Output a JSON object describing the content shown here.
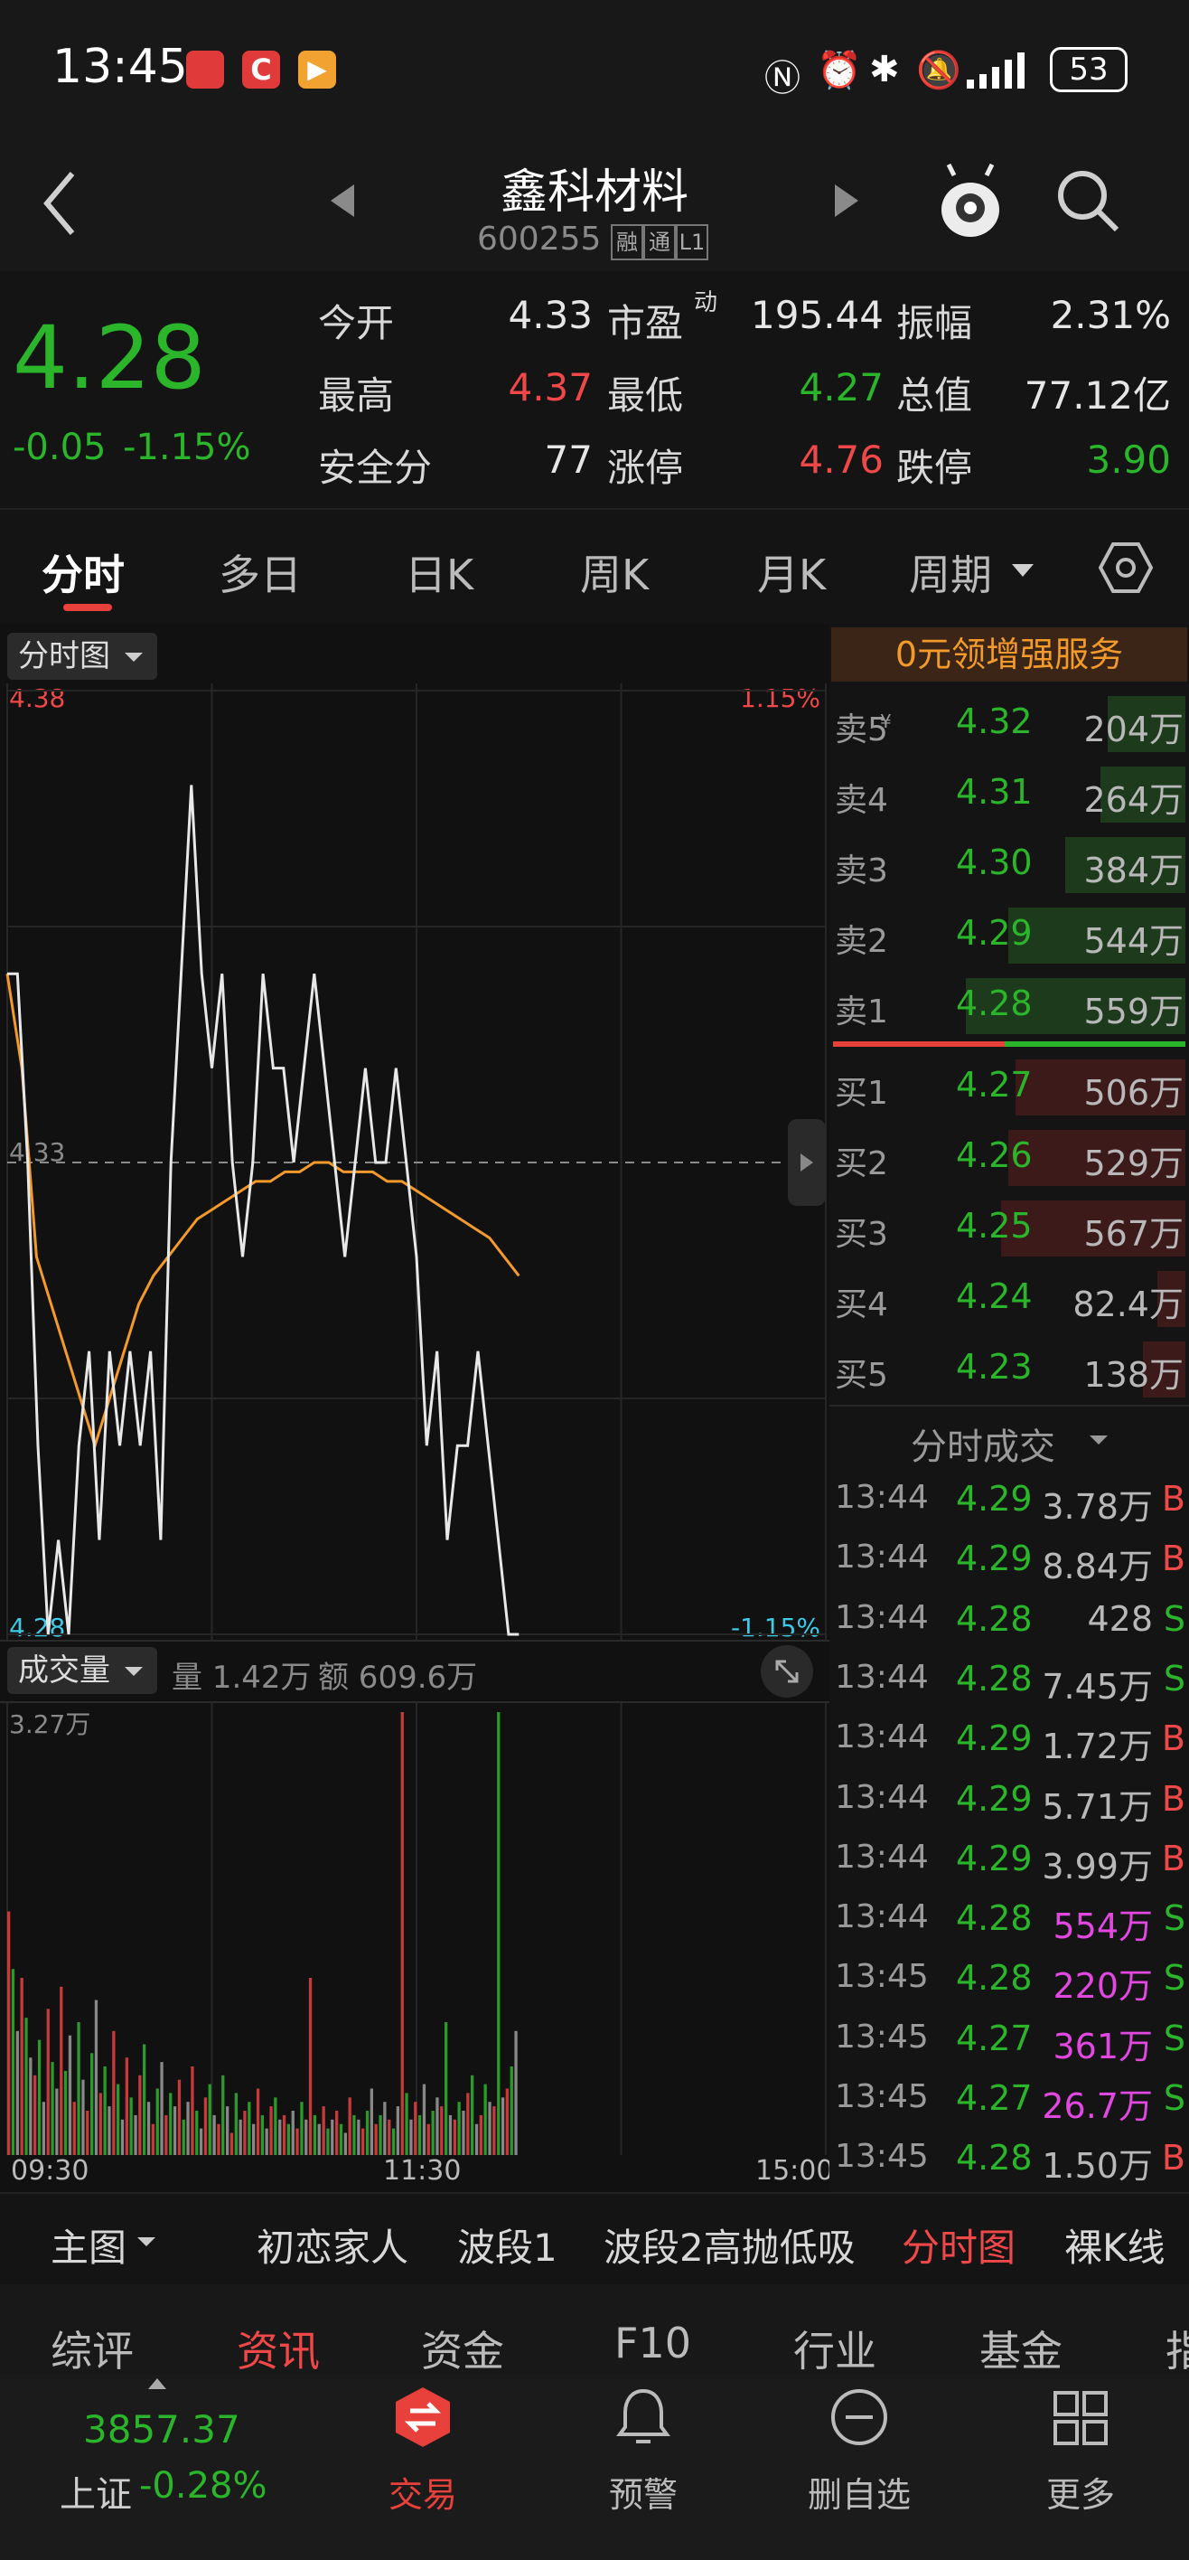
{
  "status": {
    "time": "13:45",
    "battery": "53"
  },
  "header": {
    "title": "鑫科材料",
    "code": "600255",
    "badges": [
      "融",
      "通",
      "L1"
    ]
  },
  "quote": {
    "price": "4.28",
    "change": "-0.05",
    "change_pct": "-1.15%",
    "fields": [
      {
        "label": "今开",
        "value": "4.33"
      },
      {
        "label": "市盈",
        "sup": "动",
        "value": "195.44"
      },
      {
        "label": "振幅",
        "value": "2.31%"
      },
      {
        "label": "最高",
        "value": "4.37"
      },
      {
        "label": "最低",
        "value": "4.27"
      },
      {
        "label": "总值",
        "value": "77.12亿"
      },
      {
        "label": "安全分",
        "value": "77"
      },
      {
        "label": "涨停",
        "value": "4.76"
      },
      {
        "label": "跌停",
        "value": "3.90"
      }
    ]
  },
  "tabs": [
    "分时",
    "多日",
    "日K",
    "周K",
    "月K",
    "周期"
  ],
  "chart": {
    "selector": "分时图",
    "price_top": "4.38",
    "pct_top": "1.15%",
    "price_mid": "4.33",
    "price_bottom": "4.28",
    "pct_bottom": "-1.15%",
    "vol_selector": "成交量",
    "vol_label": "量 1.42万",
    "amt_label": "额 609.6万",
    "vol_max": "3.27万",
    "x_labels": [
      "09:30",
      "11:30",
      "15:00"
    ]
  },
  "chart_data": {
    "type": "line",
    "title": "",
    "x_range": [
      "09:30",
      "15:00"
    ],
    "y_range": [
      4.28,
      4.38
    ],
    "prev_close": 4.33,
    "series": [
      {
        "values": [
          4.35,
          4.35,
          4.33,
          4.3,
          4.28,
          4.29,
          4.28,
          4.3,
          4.31,
          4.29,
          4.31,
          4.3,
          4.31,
          4.3,
          4.31,
          4.29,
          4.33,
          4.35,
          4.37,
          4.35,
          4.34,
          4.35,
          4.33,
          4.32,
          4.33,
          4.35,
          4.34,
          4.34,
          4.33,
          4.34,
          4.35,
          4.34,
          4.33,
          4.32,
          4.33,
          4.34,
          4.33,
          4.33,
          4.34,
          4.33,
          4.32,
          4.3,
          4.31,
          4.29,
          4.3,
          4.3,
          4.31,
          4.3,
          4.29,
          4.28,
          4.28
        ]
      },
      {
        "values": [
          4.35,
          4.34,
          4.32,
          4.315,
          4.31,
          4.305,
          4.3,
          4.305,
          4.31,
          4.315,
          4.318,
          4.32,
          4.322,
          4.324,
          4.325,
          4.326,
          4.327,
          4.328,
          4.328,
          4.329,
          4.329,
          4.33,
          4.33,
          4.329,
          4.329,
          4.329,
          4.328,
          4.328,
          4.327,
          4.326,
          4.325,
          4.324,
          4.323,
          4.322,
          4.32,
          4.318
        ]
      }
    ]
  },
  "volume_bars": [
    0.55,
    0.42,
    0.28,
    0.4,
    0.31,
    0.22,
    0.18,
    0.26,
    0.12,
    0.33,
    0.21,
    0.15,
    0.38,
    0.19,
    0.27,
    0.12,
    0.3,
    0.17,
    0.1,
    0.23,
    0.35,
    0.14,
    0.2,
    0.11,
    0.28,
    0.16,
    0.08,
    0.22,
    0.13,
    0.09,
    0.18,
    0.25,
    0.12,
    0.07,
    0.15,
    0.21,
    0.09,
    0.14,
    0.11,
    0.17,
    0.08,
    0.12,
    0.2,
    0.1,
    0.06,
    0.13,
    0.16,
    0.09,
    0.07,
    0.18,
    0.11,
    0.05,
    0.14,
    0.08,
    0.1,
    0.12,
    0.07,
    0.15,
    0.09,
    0.06,
    0.11,
    0.13,
    0.08,
    0.09,
    0.07,
    0.1,
    0.06,
    0.12,
    0.08,
    0.4,
    0.09,
    0.07,
    0.11,
    0.06,
    0.08,
    0.1,
    0.07,
    0.05,
    0.13,
    0.09,
    0.08,
    0.06,
    0.1,
    0.15,
    0.07,
    0.09,
    0.12,
    0.08,
    0.06,
    0.11,
    1.0,
    0.14,
    0.08,
    0.12,
    0.09,
    0.16,
    0.07,
    0.1,
    0.13,
    0.11,
    0.3,
    0.09,
    0.08,
    0.12,
    0.1,
    0.14,
    0.18,
    0.07,
    0.09,
    0.16,
    0.12,
    0.11,
    1.0,
    0.13,
    0.15,
    0.2,
    0.28
  ],
  "book": {
    "promo": "0元领增强服务",
    "asks": [
      {
        "label": "卖5",
        "price": "4.32",
        "vol": "204万",
        "bar": 0.22
      },
      {
        "label": "卖4",
        "price": "4.31",
        "vol": "264万",
        "bar": 0.24
      },
      {
        "label": "卖3",
        "price": "4.30",
        "vol": "384万",
        "bar": 0.34
      },
      {
        "label": "卖2",
        "price": "4.29",
        "vol": "544万",
        "bar": 0.5
      },
      {
        "label": "卖1",
        "price": "4.28",
        "vol": "559万",
        "bar": 0.62
      }
    ],
    "bids": [
      {
        "label": "买1",
        "price": "4.27",
        "vol": "506万",
        "bar": 0.48
      },
      {
        "label": "买2",
        "price": "4.26",
        "vol": "529万",
        "bar": 0.5
      },
      {
        "label": "买3",
        "price": "4.25",
        "vol": "567万",
        "bar": 0.52
      },
      {
        "label": "买4",
        "price": "4.24",
        "vol": "82.4万",
        "bar": 0.08
      },
      {
        "label": "买5",
        "price": "4.23",
        "vol": "138万",
        "bar": 0.12
      }
    ],
    "trades_title": "分时成交",
    "trades": [
      {
        "time": "13:44",
        "price": "4.29",
        "vol": "3.78万",
        "side": "B"
      },
      {
        "time": "13:44",
        "price": "4.29",
        "vol": "8.84万",
        "side": "B"
      },
      {
        "time": "13:44",
        "price": "4.28",
        "vol": "428",
        "side": "S"
      },
      {
        "time": "13:44",
        "price": "4.28",
        "vol": "7.45万",
        "side": "S"
      },
      {
        "time": "13:44",
        "price": "4.29",
        "vol": "1.72万",
        "side": "B"
      },
      {
        "time": "13:44",
        "price": "4.29",
        "vol": "5.71万",
        "side": "B"
      },
      {
        "time": "13:44",
        "price": "4.29",
        "vol": "3.99万",
        "side": "B"
      },
      {
        "time": "13:44",
        "price": "4.28",
        "vol": "554万",
        "side": "S",
        "big": true
      },
      {
        "time": "13:45",
        "price": "4.28",
        "vol": "220万",
        "side": "S",
        "big": true
      },
      {
        "time": "13:45",
        "price": "4.27",
        "vol": "361万",
        "side": "S",
        "big": true
      },
      {
        "time": "13:45",
        "price": "4.27",
        "vol": "26.7万",
        "side": "S",
        "big": true
      },
      {
        "time": "13:45",
        "price": "4.28",
        "vol": "1.50万",
        "side": "B"
      }
    ]
  },
  "indicators": [
    "主图",
    "初恋家人",
    "波段1",
    "波段2高抛低吸",
    "分时图",
    "裸K线"
  ],
  "bottom_tabs": [
    "综评",
    "资讯",
    "资金",
    "F10",
    "行业",
    "基金",
    "指"
  ],
  "nav": {
    "index_value": "3857.37",
    "index_name": "上证",
    "index_change": "-0.28%",
    "items": [
      "交易",
      "预警",
      "删自选",
      "更多"
    ]
  },
  "colors": {
    "up": "#f04848",
    "down": "#2ab52a",
    "price_line": "#e8e8e8",
    "avg_line": "#f39a2b",
    "accent": "#e8403a"
  }
}
